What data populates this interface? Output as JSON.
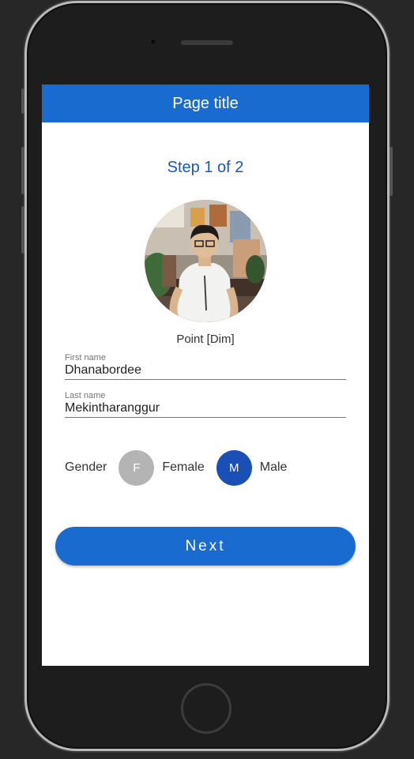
{
  "app_bar": {
    "title": "Page title"
  },
  "step": {
    "text": "Step 1 of 2"
  },
  "profile": {
    "name": "Point [Dim]"
  },
  "form": {
    "first_name": {
      "label": "First name",
      "value": "Dhanabordee"
    },
    "last_name": {
      "label": "Last name",
      "value": "Mekintharanggur"
    }
  },
  "gender": {
    "label": "Gender",
    "options": [
      {
        "initial": "F",
        "label": "Female",
        "selected": false
      },
      {
        "initial": "M",
        "label": "Male",
        "selected": true
      }
    ]
  },
  "actions": {
    "next_label": "Next"
  },
  "colors": {
    "primary": "#1a6bd0",
    "selected": "#1a50b5",
    "unselected": "#b4b4b4",
    "step_text": "#1758b8"
  }
}
